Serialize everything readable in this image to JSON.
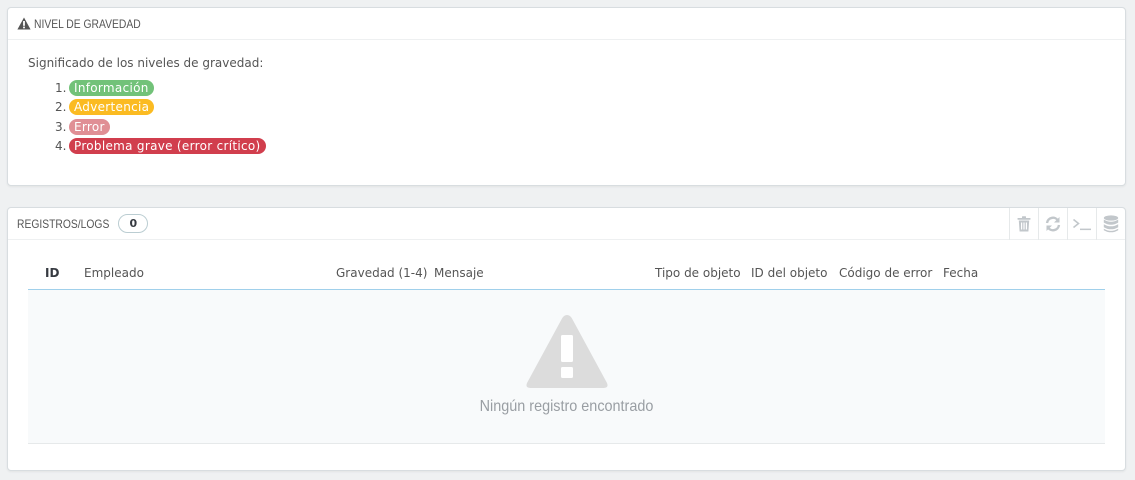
{
  "severity_panel": {
    "title": "NIVEL DE GRAVEDAD",
    "intro": "Significado de los niveles de gravedad:",
    "levels": [
      {
        "num": "1.",
        "label": "Información",
        "color": "#72c279"
      },
      {
        "num": "2.",
        "label": "Advertencia",
        "color": "#fbbb22"
      },
      {
        "num": "3.",
        "label": "Error",
        "color": "#e08f95"
      },
      {
        "num": "4.",
        "label": "Problema grave (error crítico)",
        "color": "#d13e4d"
      }
    ]
  },
  "logs_panel": {
    "title": "REGISTROS/LOGS",
    "count": "0",
    "toolbar": {
      "icons": [
        "trash-icon",
        "refresh-icon",
        "terminal-icon",
        "database-icon"
      ]
    },
    "columns": [
      "ID",
      "Empleado",
      "Gravedad (1-4)",
      "Mensaje",
      "Tipo de objeto",
      "ID del objeto",
      "Código de error",
      "Fecha"
    ],
    "empty_message": "Ningún registro encontrado"
  },
  "colors": {
    "table_header_border": "#a0d0eb",
    "empty_icon": "#dcdcdc"
  }
}
